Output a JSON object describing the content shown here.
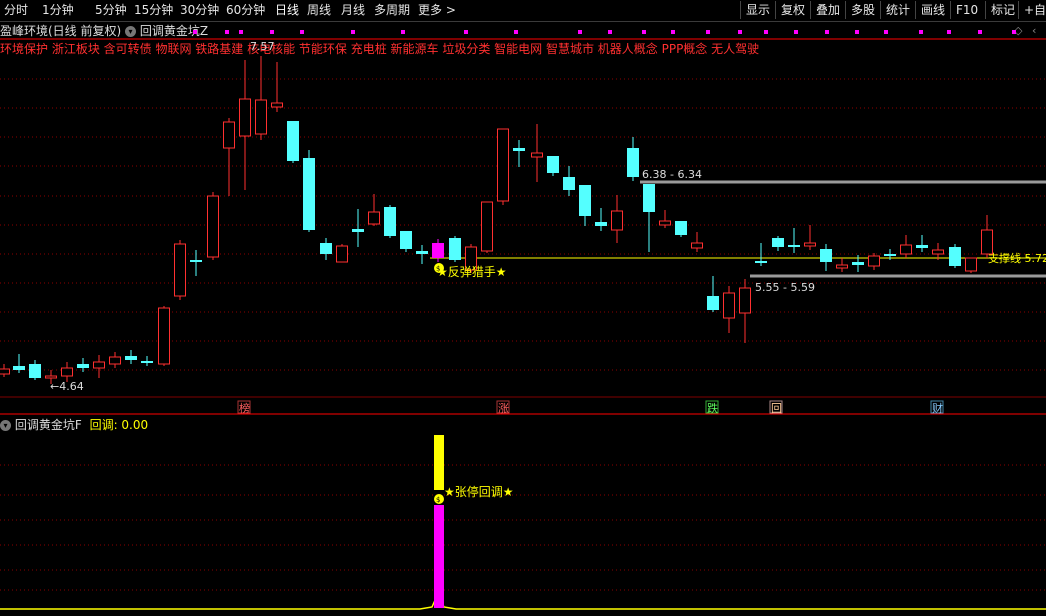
{
  "toolbar": {
    "periods": [
      "分时",
      "1分钟",
      "5分钟",
      "15分钟",
      "30分钟",
      "60分钟",
      "日线",
      "周线",
      "月线",
      "多周期",
      "更多"
    ],
    "more_arrow": ">",
    "right_buttons": [
      "显示",
      "复权",
      "叠加",
      "多股",
      "统计",
      "画线",
      "F10",
      "标记",
      "+自选"
    ]
  },
  "info": {
    "stock_name": "盈峰环境(日线 前复权)",
    "formula": "回调黄金坑Z"
  },
  "concepts": "环境保护 浙江板块 含可转债 物联网 铁路基建 核电核能 节能环保 充电桩 新能源车 垃圾分类 智能电网 智慧城市 机器人概念 PPP概念 无人驾驶",
  "annotations": {
    "high": "7.57",
    "low": "←4.64",
    "resistance": "6.38 - 6.34",
    "support": "5.55 - 5.59",
    "support_line": "支撑线 5.72",
    "signal_main": "★反弹猎手★"
  },
  "markers": [
    "榜",
    "涨",
    "跌",
    "回",
    "财"
  ],
  "indicator": {
    "name": "回调黄金坑F",
    "value_label": "回调: 0.00",
    "signal": "★张停回调★"
  },
  "colors": {
    "up": "#ff3030",
    "down": "#54ffff",
    "yellow": "#ffff00",
    "magenta": "#ff00ff",
    "gray_line": "#9a9a9a"
  }
}
